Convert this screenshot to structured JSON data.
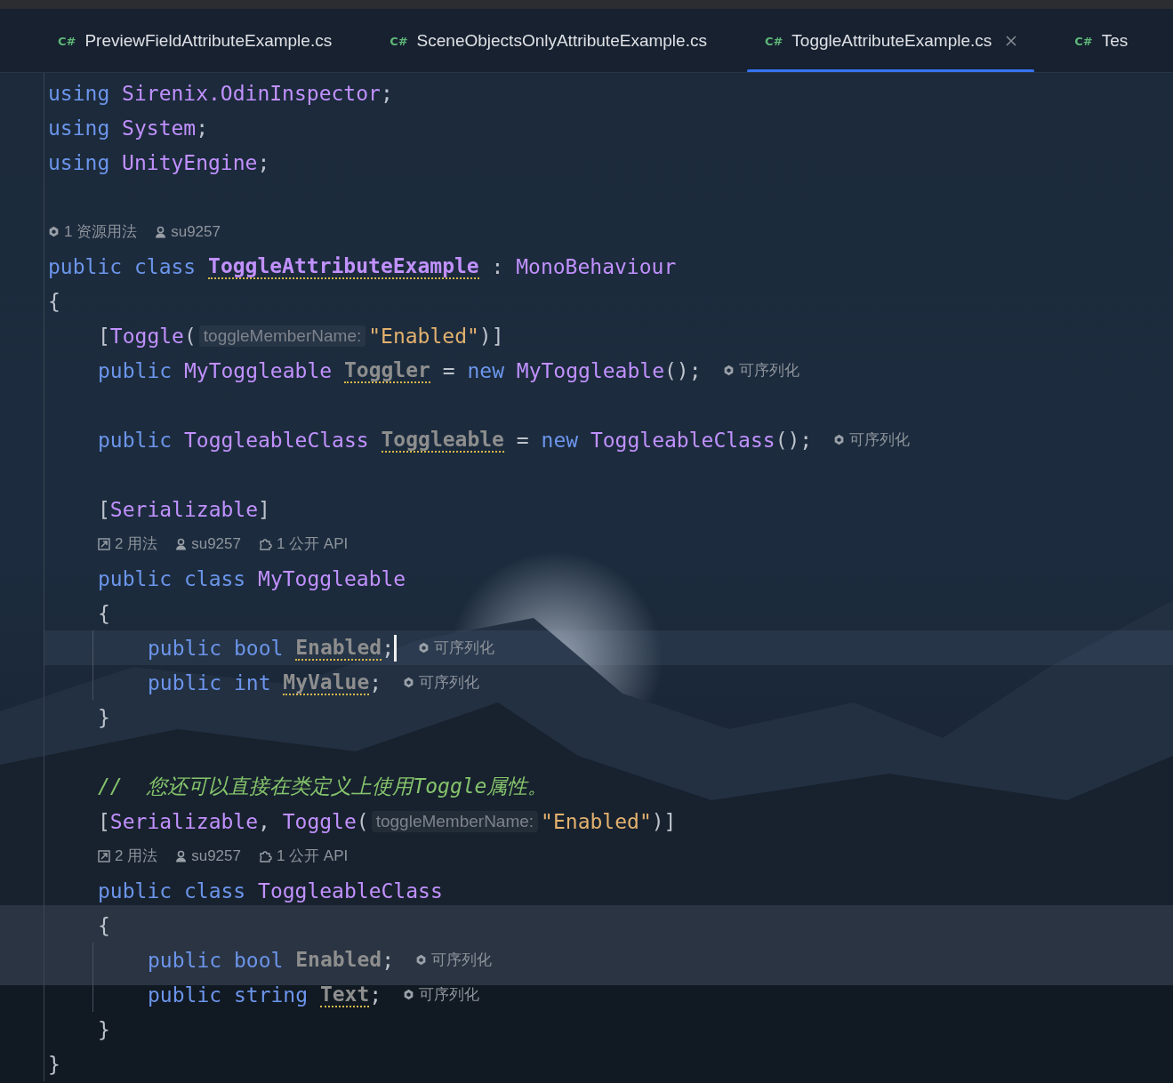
{
  "tabs": [
    {
      "badge": "C#",
      "label": "PreviewFieldAttributeExample.cs",
      "selected": false
    },
    {
      "badge": "C#",
      "label": "SceneObjectsOnlyAttributeExample.cs",
      "selected": false
    },
    {
      "badge": "C#",
      "label": "ToggleAttributeExample.cs",
      "selected": true
    },
    {
      "badge": "C#",
      "label": "Tes",
      "selected": false
    }
  ],
  "code": [
    {
      "kind": "code",
      "current": false,
      "tokens": [
        {
          "kind": "kw",
          "text": "using "
        },
        {
          "kind": "type",
          "text": "Sirenix.OdinInspector"
        },
        {
          "kind": "punct",
          "text": ";"
        }
      ]
    },
    {
      "kind": "code",
      "current": false,
      "tokens": [
        {
          "kind": "kw",
          "text": "using "
        },
        {
          "kind": "type",
          "text": "System"
        },
        {
          "kind": "punct",
          "text": ";"
        }
      ]
    },
    {
      "kind": "code",
      "current": false,
      "tokens": [
        {
          "kind": "kw",
          "text": "using "
        },
        {
          "kind": "type",
          "text": "UnityEngine"
        },
        {
          "kind": "punct",
          "text": ";"
        }
      ]
    },
    {
      "kind": "blank"
    },
    {
      "kind": "hint",
      "items": [
        {
          "kind": "assets",
          "text": "1 资源用法"
        },
        {
          "kind": "author",
          "text": "su9257"
        }
      ]
    },
    {
      "kind": "code",
      "current": false,
      "tokens": [
        {
          "kind": "kw",
          "text": "public "
        },
        {
          "kind": "kw",
          "text": "class "
        },
        {
          "kind": "class-decl",
          "warn": true,
          "text": "ToggleAttributeExample"
        },
        {
          "kind": "punct",
          "text": " : "
        },
        {
          "kind": "type",
          "text": "MonoBehaviour"
        }
      ]
    },
    {
      "kind": "code",
      "current": false,
      "tokens": [
        {
          "kind": "punct",
          "text": "{"
        }
      ],
      "children": [
        {
          "kind": "code",
          "current": false,
          "tokens": [
            {
              "kind": "punct",
              "text": "["
            },
            {
              "kind": "type",
              "text": "Toggle"
            },
            {
              "kind": "punct",
              "text": "("
            },
            {
              "kind": "param",
              "text": "toggleMemberName:"
            },
            {
              "kind": "string",
              "text": "\"Enabled\""
            },
            {
              "kind": "punct",
              "text": ")]"
            }
          ]
        },
        {
          "kind": "code",
          "current": false,
          "tokens": [
            {
              "kind": "kw",
              "text": "public "
            },
            {
              "kind": "type",
              "text": "MyToggleable "
            },
            {
              "kind": "field-decl",
              "warn": true,
              "text": "Toggler"
            },
            {
              "kind": "punct",
              "text": " = "
            },
            {
              "kind": "kw",
              "text": "new "
            },
            {
              "kind": "type",
              "text": "MyToggleable"
            },
            {
              "kind": "punct",
              "text": "();"
            },
            {
              "kind": "inlay",
              "text": "可序列化"
            }
          ]
        },
        {
          "kind": "blank"
        },
        {
          "kind": "code",
          "current": false,
          "tokens": [
            {
              "kind": "kw",
              "text": "public "
            },
            {
              "kind": "type",
              "text": "ToggleableClass "
            },
            {
              "kind": "field-decl",
              "warn": true,
              "text": "Toggleable"
            },
            {
              "kind": "punct",
              "text": " = "
            },
            {
              "kind": "kw",
              "text": "new "
            },
            {
              "kind": "type",
              "text": "ToggleableClass"
            },
            {
              "kind": "punct",
              "text": "();"
            },
            {
              "kind": "inlay",
              "text": "可序列化"
            }
          ]
        },
        {
          "kind": "blank"
        },
        {
          "kind": "code",
          "current": false,
          "tokens": [
            {
              "kind": "punct",
              "text": "["
            },
            {
              "kind": "type",
              "text": "Serializable"
            },
            {
              "kind": "punct",
              "text": "]"
            }
          ]
        },
        {
          "kind": "hint",
          "items": [
            {
              "kind": "usages",
              "text": "2 用法"
            },
            {
              "kind": "author",
              "text": "su9257"
            },
            {
              "kind": "api",
              "text": "1 公开 API"
            }
          ]
        },
        {
          "kind": "code",
          "current": false,
          "tokens": [
            {
              "kind": "kw",
              "text": "public "
            },
            {
              "kind": "kw",
              "text": "class "
            },
            {
              "kind": "type",
              "text": "MyToggleable"
            }
          ]
        },
        {
          "kind": "code",
          "current": false,
          "tokens": [
            {
              "kind": "punct",
              "text": "{"
            }
          ],
          "children": [
            {
              "kind": "code",
              "current": true,
              "tokens": [
                {
                  "kind": "kw",
                  "text": "public "
                },
                {
                  "kind": "kw",
                  "text": "bool "
                },
                {
                  "kind": "field-decl",
                  "warn": true,
                  "text": "Enabled"
                },
                {
                  "kind": "punct",
                  "text": ";"
                },
                {
                  "kind": "inlay",
                  "text": "可序列化"
                }
              ]
            },
            {
              "kind": "code",
              "current": false,
              "tokens": [
                {
                  "kind": "kw",
                  "text": "public "
                },
                {
                  "kind": "kw",
                  "text": "int "
                },
                {
                  "kind": "field-decl",
                  "warn": true,
                  "text": "MyValue"
                },
                {
                  "kind": "punct",
                  "text": ";"
                },
                {
                  "kind": "inlay",
                  "text": "可序列化"
                }
              ]
            }
          ]
        },
        {
          "kind": "code",
          "current": false,
          "tokens": [
            {
              "kind": "punct",
              "text": "}"
            }
          ]
        },
        {
          "kind": "blank"
        },
        {
          "kind": "code",
          "current": false,
          "tokens": [
            {
              "kind": "comment",
              "text": "//  您还可以直接在类定义上使用Toggle属性。"
            }
          ]
        },
        {
          "kind": "code",
          "current": false,
          "tokens": [
            {
              "kind": "punct",
              "text": "["
            },
            {
              "kind": "type",
              "text": "Serializable"
            },
            {
              "kind": "punct",
              "text": ", "
            },
            {
              "kind": "type",
              "text": "Toggle"
            },
            {
              "kind": "punct",
              "text": "("
            },
            {
              "kind": "param",
              "text": "toggleMemberName:"
            },
            {
              "kind": "string",
              "text": "\"Enabled\""
            },
            {
              "kind": "punct",
              "text": ")]"
            }
          ]
        },
        {
          "kind": "hint",
          "items": [
            {
              "kind": "usages",
              "text": "2 用法"
            },
            {
              "kind": "author",
              "text": "su9257"
            },
            {
              "kind": "api",
              "text": "1 公开 API"
            }
          ]
        },
        {
          "kind": "code",
          "current": false,
          "tokens": [
            {
              "kind": "kw",
              "text": "public "
            },
            {
              "kind": "kw",
              "text": "class "
            },
            {
              "kind": "type",
              "text": "ToggleableClass"
            }
          ]
        },
        {
          "kind": "code",
          "current": false,
          "tokens": [
            {
              "kind": "punct",
              "text": "{"
            }
          ],
          "children": [
            {
              "kind": "code",
              "current": false,
              "tokens": [
                {
                  "kind": "kw",
                  "text": "public "
                },
                {
                  "kind": "kw",
                  "text": "bool "
                },
                {
                  "kind": "field-decl",
                  "warn": false,
                  "text": "Enabled"
                },
                {
                  "kind": "punct",
                  "text": ";"
                },
                {
                  "kind": "inlay",
                  "text": "可序列化"
                }
              ]
            },
            {
              "kind": "code",
              "current": false,
              "tokens": [
                {
                  "kind": "kw",
                  "text": "public "
                },
                {
                  "kind": "kw",
                  "text": "string "
                },
                {
                  "kind": "field-decl",
                  "warn": true,
                  "text": "Text"
                },
                {
                  "kind": "punct",
                  "text": ";"
                },
                {
                  "kind": "inlay",
                  "text": "可序列化"
                }
              ]
            }
          ]
        },
        {
          "kind": "code",
          "current": false,
          "tokens": [
            {
              "kind": "punct",
              "text": "}"
            }
          ]
        }
      ]
    },
    {
      "kind": "code",
      "current": false,
      "tokens": [
        {
          "kind": "punct",
          "text": "}"
        }
      ]
    }
  ]
}
